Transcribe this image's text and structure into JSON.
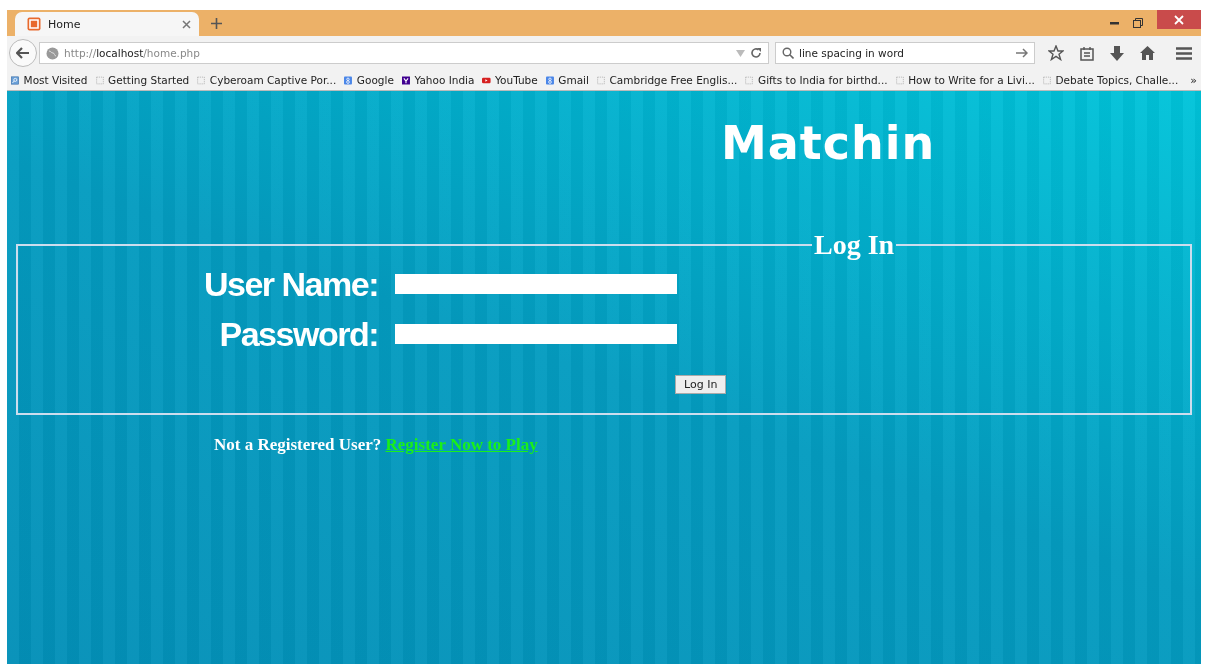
{
  "browser": {
    "tab": {
      "title": "Home",
      "selected": true
    },
    "address": {
      "prefix": "http://",
      "host": "localhost",
      "path": "/home.php"
    },
    "search": {
      "value": "line spacing in word"
    },
    "bookmarks": [
      {
        "label": "Most Visited",
        "kind": "folder"
      },
      {
        "label": "Getting Started",
        "kind": "blank"
      },
      {
        "label": "Cyberoam Captive Por...",
        "kind": "blank"
      },
      {
        "label": "Google",
        "kind": "google"
      },
      {
        "label": "Yahoo India",
        "kind": "yahoo"
      },
      {
        "label": "YouTube",
        "kind": "youtube"
      },
      {
        "label": "Gmail",
        "kind": "google"
      },
      {
        "label": "Cambridge Free Englis...",
        "kind": "blank"
      },
      {
        "label": "Gifts to India for birthd...",
        "kind": "blank"
      },
      {
        "label": "How to Write for a Livi...",
        "kind": "blank"
      },
      {
        "label": "Debate Topics, Challe...",
        "kind": "blank"
      }
    ],
    "overflow": "»"
  },
  "page": {
    "logo": "Matchin",
    "login": {
      "legend": "Log In",
      "fields": [
        {
          "label": "User Name:"
        },
        {
          "label": "Password:"
        }
      ],
      "button": "Log In"
    },
    "register": {
      "text": "Not a Registered User?",
      "link": "Register Now to Play"
    }
  }
}
